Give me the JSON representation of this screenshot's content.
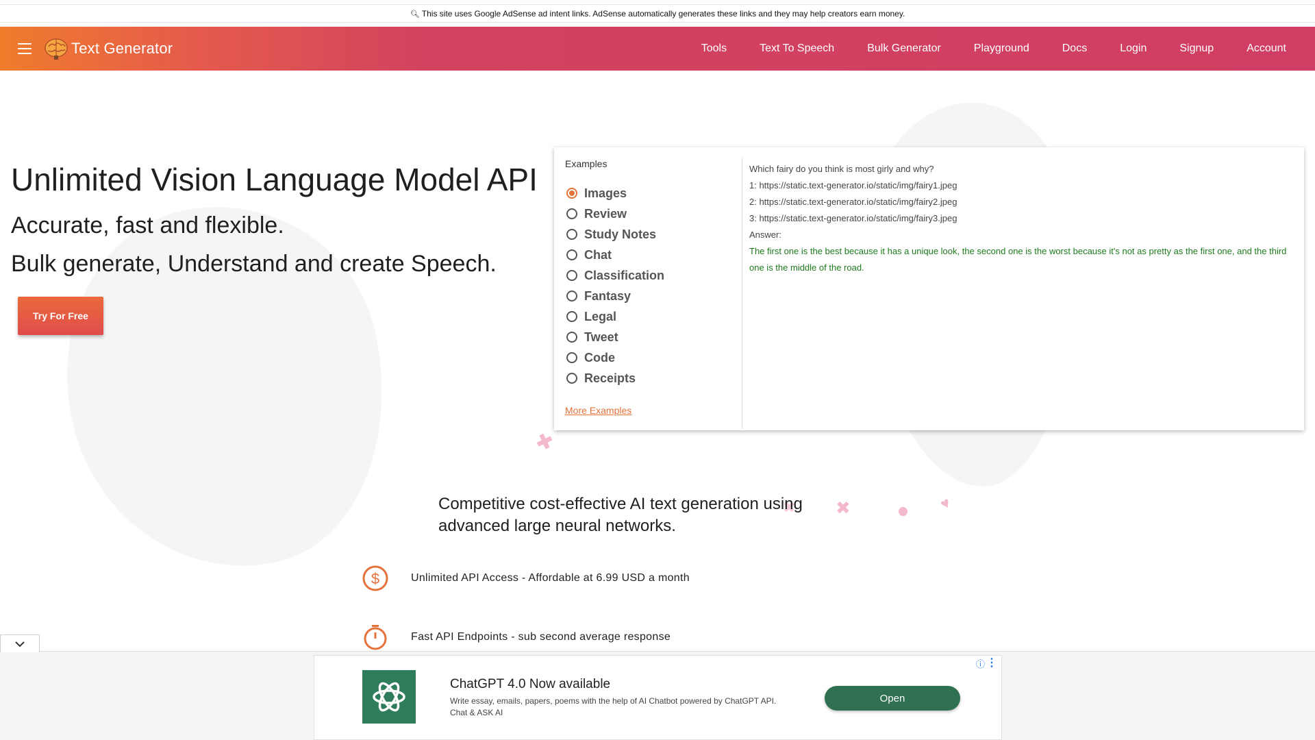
{
  "notice": {
    "text": "This site uses Google AdSense ad intent links. AdSense automatically generates these links and they may help creators earn money."
  },
  "header": {
    "brand": "Text Generator",
    "nav": [
      "Tools",
      "Text To Speech",
      "Bulk Generator",
      "Playground",
      "Docs",
      "Login",
      "Signup",
      "Account"
    ]
  },
  "hero": {
    "title": "Unlimited Vision Language Model API",
    "subtitle1": "Accurate, fast and flexible.",
    "subtitle2": "Bulk generate, Understand and create Speech.",
    "cta": "Try For Free"
  },
  "examples": {
    "heading": "Examples",
    "items": [
      "Images",
      "Review",
      "Study Notes",
      "Chat",
      "Classification",
      "Fantasy",
      "Legal",
      "Tweet",
      "Code",
      "Receipts"
    ],
    "selected": "Images",
    "more_link": "More Examples",
    "prompt_lines": [
      "Which fairy do you think is most girly and why?",
      "1: https://static.text-generator.io/static/img/fairy1.jpeg",
      "2: https://static.text-generator.io/static/img/fairy2.jpeg",
      "3: https://static.text-generator.io/static/img/fairy3.jpeg",
      "Answer:"
    ],
    "answer": "The first one is the best because it has a unique look, the second one is the worst because it's not as pretty as the first one, and the third one is the middle of the road."
  },
  "features": {
    "tagline": "Competitive cost-effective AI text generation using advanced large neural networks.",
    "items": [
      {
        "icon": "dollar-icon",
        "text": "Unlimited API Access - Affordable at 6.99 USD a month"
      },
      {
        "icon": "timer-icon",
        "text": "Fast API Endpoints - sub second average response"
      }
    ]
  },
  "ad": {
    "title": "ChatGPT 4.0 Now available",
    "description": "Write essay, emails, papers, poems with the help of AI Chatbot powered by ChatGPT API. Chat & ASK AI",
    "button": "Open"
  },
  "colors": {
    "accent": "#e2733a",
    "header_start": "#f07c2c",
    "header_end": "#d03e63",
    "answer": "#1e7b1e",
    "ad_button": "#2f7050"
  }
}
